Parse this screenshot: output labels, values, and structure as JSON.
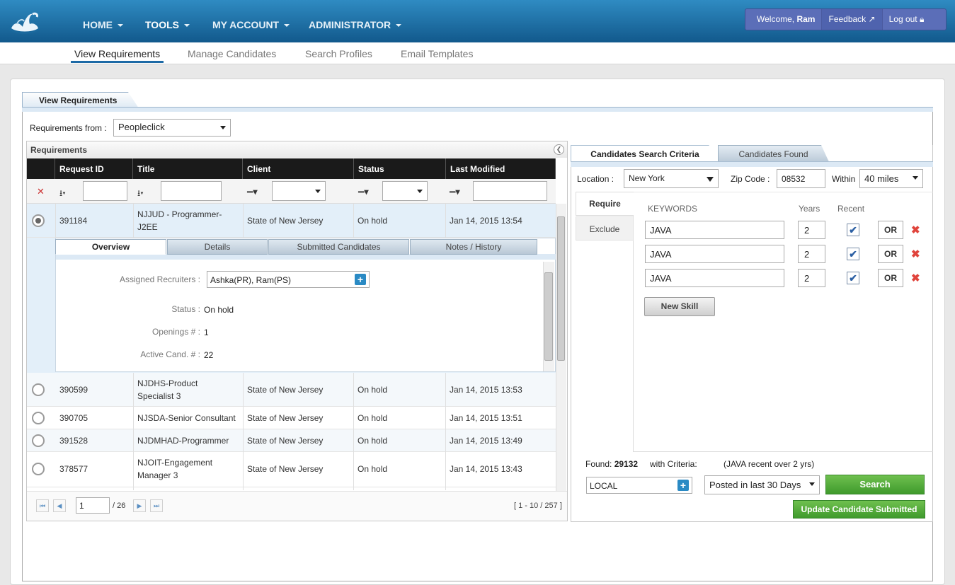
{
  "nav": {
    "items": [
      {
        "label": "HOME"
      },
      {
        "label": "TOOLS"
      },
      {
        "label": "MY ACCOUNT"
      },
      {
        "label": "ADMINISTRATOR"
      }
    ],
    "welcome_prefix": "Welcome, ",
    "welcome_user": "Ram",
    "feedback": "Feedback",
    "logout": "Log out"
  },
  "subnav": {
    "items": [
      {
        "label": "View Requirements",
        "active": true
      },
      {
        "label": "Manage Candidates"
      },
      {
        "label": "Search Profiles"
      },
      {
        "label": "Email Templates"
      }
    ]
  },
  "page": {
    "tab": "View Requirements",
    "req_from_label": "Requirements from :",
    "req_from_value": "Peopleclick"
  },
  "requirements": {
    "title": "Requirements",
    "columns": [
      "Request ID",
      "Title",
      "Client",
      "Status",
      "Last Modified"
    ],
    "rows": [
      {
        "id": "391184",
        "title": "NJJUD - Programmer-J2EE",
        "client": "State of New Jersey",
        "status": "On hold",
        "modified": "Jan 14, 2015 13:54",
        "selected": true
      },
      {
        "id": "390599",
        "title": "NJDHS-Product Specialist 3",
        "client": "State of New Jersey",
        "status": "On hold",
        "modified": "Jan 14, 2015 13:53"
      },
      {
        "id": "390705",
        "title": "NJSDA-Senior Consultant",
        "client": "State of New Jersey",
        "status": "On hold",
        "modified": "Jan 14, 2015 13:51"
      },
      {
        "id": "391528",
        "title": "NJDMHAD-Programmer",
        "client": "State of New Jersey",
        "status": "On hold",
        "modified": "Jan 14, 2015 13:49"
      },
      {
        "id": "378577",
        "title": "NJOIT-Engagement Manager 3",
        "client": "State of New Jersey",
        "status": "On hold",
        "modified": "Jan 14, 2015 13:43"
      }
    ],
    "detail_tabs": [
      "Overview",
      "Details",
      "Submitted Candidates",
      "Notes / History"
    ],
    "detail": {
      "recruiters_label": "Assigned Recruiters :",
      "recruiters_value": "Ashka(PR), Ram(PS)",
      "status_label": "Status :",
      "status_value": "On hold",
      "openings_label": "Openings # :",
      "openings_value": "1",
      "active_label": "Active Cand. # :",
      "active_value": "22"
    },
    "pager": {
      "page": "1",
      "total": "/ 26",
      "range": "[ 1 - 10 / 257 ]"
    }
  },
  "search": {
    "tabs": [
      "Candidates Search Criteria",
      "Candidates Found"
    ],
    "location_label": "Location :",
    "location_value": "New York",
    "zip_label": "Zip Code :",
    "zip_value": "08532",
    "within_label": "Within",
    "within_value": "40 miles",
    "side_tabs": [
      "Require",
      "Exclude"
    ],
    "headers": {
      "keywords": "KEYWORDS",
      "years": "Years",
      "recent": "Recent"
    },
    "skills": [
      {
        "keyword": "JAVA",
        "years": "2",
        "recent": true,
        "op": "OR"
      },
      {
        "keyword": "JAVA",
        "years": "2",
        "recent": true,
        "op": "OR"
      },
      {
        "keyword": "JAVA",
        "years": "2",
        "recent": true,
        "op": "OR"
      }
    ],
    "new_skill": "New Skill",
    "found_label": "Found:",
    "found_count": "29132",
    "criteria_label": "with Criteria:",
    "criteria_value": "(JAVA recent over 2 yrs)",
    "source_value": "LOCAL",
    "posted_value": "Posted in last 30 Days",
    "search_button": "Search",
    "update_button": "Update Candidate Submitted"
  }
}
